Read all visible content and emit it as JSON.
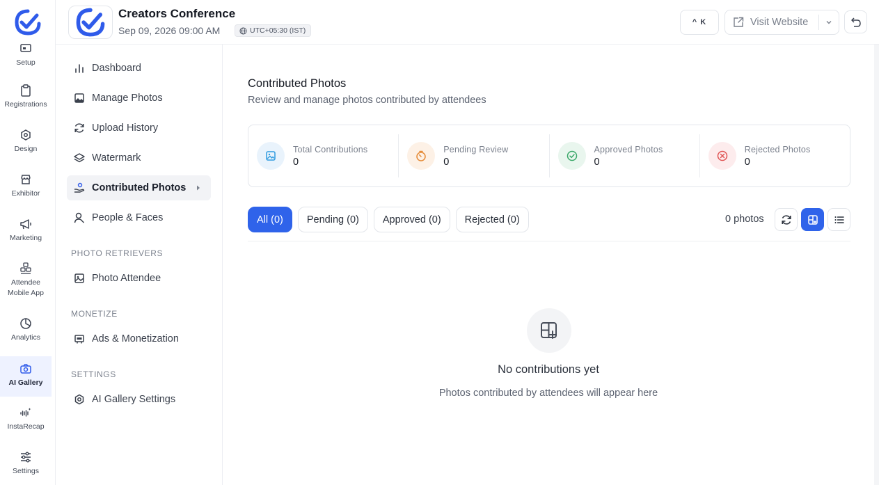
{
  "rail": {
    "items": [
      {
        "label": "Setup",
        "icon": "setup-icon"
      },
      {
        "label": "Registrations",
        "icon": "clipboard-icon"
      },
      {
        "label": "Design",
        "icon": "design-icon"
      },
      {
        "label": "Exhibitor",
        "icon": "store-icon"
      },
      {
        "label": "Marketing",
        "icon": "megaphone-icon"
      },
      {
        "label": "Attendee",
        "label2": "Mobile App",
        "icon": "mobile-app-icon"
      },
      {
        "label": "Analytics",
        "icon": "pie-chart-icon"
      },
      {
        "label": "AI Gallery",
        "icon": "camera-icon"
      },
      {
        "label": "InstaRecap",
        "icon": "sparkle-wave-icon"
      },
      {
        "label": "Settings",
        "icon": "sliders-icon"
      }
    ],
    "active": "AI Gallery"
  },
  "header": {
    "event_title": "Creators Conference",
    "event_date": "Sep 09, 2026 09:00 AM",
    "timezone": "UTC+05:30 (IST)",
    "shortcut": "^ K",
    "visit_website": "Visit Website"
  },
  "subnav": {
    "items": [
      {
        "label": "Dashboard",
        "icon": "bar-chart-icon"
      },
      {
        "label": "Manage Photos",
        "icon": "image-icon"
      },
      {
        "label": "Upload History",
        "icon": "refresh-icon"
      },
      {
        "label": "Watermark",
        "icon": "layers-icon"
      },
      {
        "label": "Contributed Photos",
        "icon": "hand-coin-icon"
      },
      {
        "label": "People & Faces",
        "icon": "user-icon"
      }
    ],
    "section_retrievers": "PHOTO RETRIEVERS",
    "photo_attendee": "Photo Attendee",
    "section_monetize": "MONETIZE",
    "ads": "Ads & Monetization",
    "section_settings": "SETTINGS",
    "gallery_settings": "AI Gallery Settings",
    "active": "Contributed Photos"
  },
  "main": {
    "title": "Contributed Photos",
    "subtitle": "Review and manage photos contributed by attendees",
    "stats": [
      {
        "label": "Total Contributions",
        "value": "0",
        "color": "#2f9be0",
        "bg": "#e9f3fc"
      },
      {
        "label": "Pending Review",
        "value": "0",
        "color": "#e58a36",
        "bg": "#fdf1e6"
      },
      {
        "label": "Approved Photos",
        "value": "0",
        "color": "#3aa869",
        "bg": "#e9f6ee"
      },
      {
        "label": "Rejected Photos",
        "value": "0",
        "color": "#e05454",
        "bg": "#fdeced"
      }
    ],
    "tabs": [
      "All (0)",
      "Pending (0)",
      "Approved (0)",
      "Rejected (0)"
    ],
    "active_tab": "All (0)",
    "photo_count": "0 photos",
    "empty_title": "No contributions yet",
    "empty_subtitle": "Photos contributed by attendees will appear here"
  },
  "colors": {
    "accent": "#2f63ea",
    "logo": "#2f5bea"
  }
}
